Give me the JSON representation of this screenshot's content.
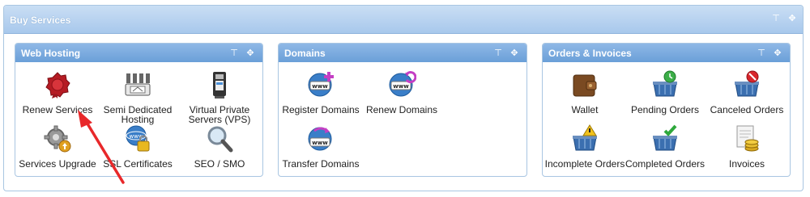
{
  "outer": {
    "title": "Buy Services"
  },
  "panels": [
    {
      "title": "Web Hosting",
      "items": [
        {
          "label": "Renew Services",
          "icon": "renew-seal-icon"
        },
        {
          "label": "Semi Dedicated Hosting",
          "icon": "server-rack-icon"
        },
        {
          "label": "Virtual Private Servers (VPS)",
          "icon": "vps-server-icon"
        },
        {
          "label": "Services Upgrade",
          "icon": "gear-upgrade-icon"
        },
        {
          "label": "SSL Certificates",
          "icon": "ssl-lock-icon"
        },
        {
          "label": "SEO / SMO",
          "icon": "magnifier-icon"
        }
      ]
    },
    {
      "title": "Domains",
      "items": [
        {
          "label": "Register Domains",
          "icon": "www-add-icon"
        },
        {
          "label": "Renew Domains",
          "icon": "www-renew-icon"
        },
        {
          "label": "Transfer Domains",
          "icon": "www-transfer-icon"
        }
      ]
    },
    {
      "title": "Orders & Invoices",
      "items": [
        {
          "label": "Wallet",
          "icon": "wallet-icon"
        },
        {
          "label": "Pending Orders",
          "icon": "basket-pending-icon"
        },
        {
          "label": "Canceled Orders",
          "icon": "basket-canceled-icon"
        },
        {
          "label": "Incomplete Orders",
          "icon": "basket-warning-icon"
        },
        {
          "label": "Completed Orders",
          "icon": "basket-check-icon"
        },
        {
          "label": "Invoices",
          "icon": "invoice-coins-icon"
        }
      ]
    }
  ],
  "colors": {
    "header": "#a8c8ec",
    "panel_header": "#6a9fd8",
    "border": "#a9c6e2",
    "arrow": "#e8282a"
  }
}
